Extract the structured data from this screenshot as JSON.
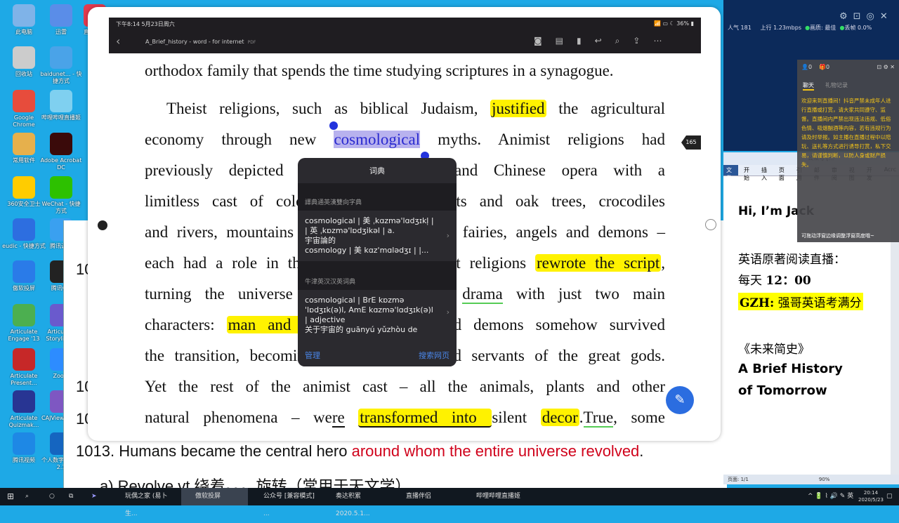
{
  "desktop": {
    "icons": [
      "此电脑",
      "迅雷",
      "直播伴侣",
      "回收站",
      "baidunet... - 快捷方式",
      "Google Chrome",
      "哔哩哔哩直播姬",
      "常用软件",
      "Adobe Acrobat DC",
      "360安全卫士",
      "WeChat - 快捷方式",
      "eudic - 快捷方式",
      "腾讯课堂",
      "傲软投屏",
      "腾讯QQ",
      "Articulate Engage '13",
      "Articulate Storyline 3",
      "Articulate Present...",
      "Zoom",
      "Articulate Quizmak...",
      "CAJViewer 7.2",
      "腾讯视频",
      "个人数字图书馆2.1"
    ]
  },
  "ipad": {
    "status_time": "下午8:14  5月23日周六",
    "battery": "36%",
    "doc_title": "A_Brief_history - word - for internet",
    "doc_type": "PDF",
    "page_badge": "165",
    "lines": [
      "orthodox family that spends the time studying scriptures in a synagogue.",
      [
        "Theist religions, such as biblical Judaism,",
        "justified",
        "the agricultural"
      ],
      [
        "economy through new",
        "cosmological",
        "myths. Animist religions had"
      ],
      "previously depicted the world as a grand Chinese opera with a",
      "limitless cast of colourful actors. Elephants and oak trees, crocodiles",
      "and rivers, mountains and frogs, ghosts and fairies, angels and demons –",
      [
        "each had a role in the cosmic opera. Theist religions",
        "rewrote the script",
        ","
      ],
      [
        "turning the universe into a bleak Ibsen",
        "drama",
        "with just two main"
      ],
      [
        "characters:",
        "man and God",
        ". The angels and demons somehow survived"
      ],
      "the transition, becoming the messengers and servants of the great gods.",
      "Yet the rest of the animist cast – all the animals, plants and other",
      [
        "natural phenomena – we",
        "re",
        "transformed into ",
        "silent",
        "decor",
        ".",
        "True",
        ", some"
      ]
    ],
    "dictionary": {
      "title": "词典",
      "sections": [
        {
          "name": "譯典通英漢雙向字典",
          "text": [
            "cosmological | 美 ˌkɑzmə'lɑdʒɪkl̩ |",
            "| 英 ˌkɒzmə'lɒdʒikəl | a.",
            "宇宙論的",
            "cosmology | 美 kɑz'mɑlədʒɪ | |..."
          ]
        },
        {
          "name": "牛津英汉汉英词典",
          "text": [
            "cosmological | BrE kɒzmə",
            "'lɒdʒɪk(ə)l, AmE kɑzmə'lɑdʒɪk(ə)l",
            "| adjective",
            "关于宇宙的 guānyú yǔzhòu de"
          ]
        }
      ],
      "manage": "管理",
      "search_web": "搜索网页"
    }
  },
  "background_doc": {
    "numbers": [
      "10",
      "10",
      "10"
    ],
    "line_num": "1013.",
    "line_black": "Humans became the central hero",
    "line_red": "around whom the entire universe revolved",
    "line_end": ".",
    "sub": "a) Revolve  vt  绕着。。。旋转（常用于天文学）"
  },
  "stream": {
    "popularity": "人气  181",
    "upload": "上行  1.23mbps",
    "quality": "画质: 最佳",
    "drop": "丢帧 0.0%"
  },
  "chat": {
    "viewers": "0",
    "gifts": "0",
    "tabs": [
      "聊天",
      "礼物记录"
    ],
    "notice": "欢迎来到直播间！抖音严禁未成年人进行直播或打赏，请大家共同遵守、监督。直播间内严禁出现违法违规、低俗色情、吸烟酗酒等内容，若有违规行为请及时举报。如主播在直播过程中以陪玩、送礼等方式进行诱导打赏，私下交易，请谨慎判断，以防人身或财产损失。",
    "footer": "可拖动浮窗边缘调整浮窗高度哦~"
  },
  "word": {
    "title": "公众号 [...",
    "tabs": [
      "文件",
      "开始",
      "插入",
      "页面",
      "引用",
      "邮件",
      "审阅",
      "视图",
      "开发",
      "Acrc"
    ],
    "hi": "Hi, I’m Jack",
    "l1": "英语原著阅读直播：",
    "l2a": "每天 ",
    "l2b": "12：00",
    "gzh": "GZH:",
    "gzh_name": " 强哥英语考满分",
    "book_cn": "《未来简史》",
    "book1": "A Brief History",
    "book2": "of Tomorrow",
    "page": "页面: 1/1",
    "zoom": "90%"
  },
  "taskbar": {
    "items": [
      "玩偶之家 (易卜生...",
      "傲软投屏",
      "公众号 [兼容模式] ...",
      "奏达积累 2020.5.1...",
      "直播伴侣",
      "哔哩哔哩直播姬"
    ],
    "ime": "英",
    "time": "20:14",
    "date": "2020/5/23"
  },
  "colors": {
    "highlight": "#fff200",
    "selection": "#b8b2ee",
    "red_text": "#d0021b",
    "accent_blue": "#2b6de0"
  }
}
